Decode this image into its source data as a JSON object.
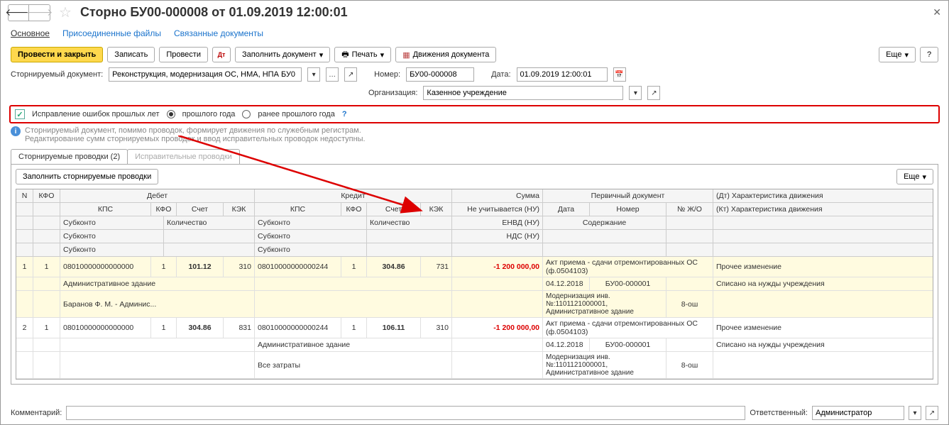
{
  "title": "Сторно БУ00-000008 от 01.09.2019 12:00:01",
  "nav_tabs": {
    "main": "Основное",
    "files": "Присоединенные файлы",
    "linked": "Связанные документы"
  },
  "toolbar": {
    "post_close": "Провести и закрыть",
    "save": "Записать",
    "post": "Провести",
    "fill_doc": "Заполнить документ",
    "print": "Печать",
    "movements": "Движения документа",
    "more": "Еще",
    "help": "?"
  },
  "form": {
    "storn_doc_lbl": "Сторнируемый документ:",
    "storn_doc_val": "Реконструкция, модернизация ОС, НМА, НПА БУ0",
    "number_lbl": "Номер:",
    "number_val": "БУ00-000008",
    "date_lbl": "Дата:",
    "date_val": "01.09.2019 12:00:01",
    "org_lbl": "Организация:",
    "org_val": "Казенное учреждение"
  },
  "corrections": {
    "checkbox_lbl": "Исправление ошибок прошлых лет",
    "radio1": "прошлого года",
    "radio2": "ранее прошлого года"
  },
  "info": {
    "line1": "Сторнируемый документ, помимо проводок, формирует движения по служебным регистрам.",
    "line2": "Редактирование сумм сторнируемых проводок и ввод исправительных проводок недоступны."
  },
  "tabs": {
    "t1": "Сторнируемые проводки (2)",
    "t2": "Исправительные проводки"
  },
  "grid_toolbar": {
    "fill": "Заполнить сторнируемые проводки",
    "more": "Еще"
  },
  "grid_headers": {
    "n": "N",
    "kfo": "КФО",
    "debit": "Дебет",
    "credit": "Кредит",
    "sum": "Сумма",
    "pdoc": "Первичный документ",
    "char_dt": "(Дт) Характеристика движения",
    "kps": "КПС",
    "kfo2": "КФО",
    "acct": "Счет",
    "kek": "КЭК",
    "not_nu": "Не учитывается (НУ)",
    "date": "Дата",
    "num": "Номер",
    "jo": "№ Ж/О",
    "char_kt": "(Кт) Характеристика движения",
    "sub": "Субконто",
    "qty": "Количество",
    "envd": "ЕНВД (НУ)",
    "content": "Содержание",
    "nds": "НДС (НУ)"
  },
  "rows": [
    {
      "n": "1",
      "kfo": "1",
      "d_kps": "08010000000000000",
      "d_kfo": "1",
      "d_acct": "101.12",
      "d_kek": "310",
      "c_kps": "08010000000000244",
      "c_kfo": "1",
      "c_acct": "304.86",
      "c_kek": "731",
      "sum": "-1 200 000,00",
      "pdoc_l1": "Акт приема - сдачи отремонтированных ОС (ф.0504103)",
      "char_dt": "Прочее изменение",
      "sub1": "Административное здание",
      "sub2": "Баранов Ф. М. - Админис...",
      "date": "04.12.2018",
      "pnum": "БУ00-000001",
      "char_kt": "Списано на нужды учреждения",
      "content": "Модернизация инв. №:1101121000001, Административное здание",
      "jo": "8-ош"
    },
    {
      "n": "2",
      "kfo": "1",
      "d_kps": "08010000000000000",
      "d_kfo": "1",
      "d_acct": "304.86",
      "d_kek": "831",
      "c_kps": "08010000000000244",
      "c_kfo": "1",
      "c_acct": "106.11",
      "c_kek": "310",
      "sum": "-1 200 000,00",
      "pdoc_l1": "Акт приема - сдачи отремонтированных ОС (ф.0504103)",
      "char_dt": "Прочее изменение",
      "sub1": "",
      "sub2": "",
      "c_sub1": "Административное здание",
      "c_sub2": "Все затраты",
      "date": "04.12.2018",
      "pnum": "БУ00-000001",
      "char_kt": "Списано на нужды учреждения",
      "content": "Модернизация инв. №:1101121000001, Административное здание",
      "jo": "8-ош"
    }
  ],
  "footer": {
    "comment_lbl": "Комментарий:",
    "resp_lbl": "Ответственный:",
    "resp_val": "Администратор"
  }
}
